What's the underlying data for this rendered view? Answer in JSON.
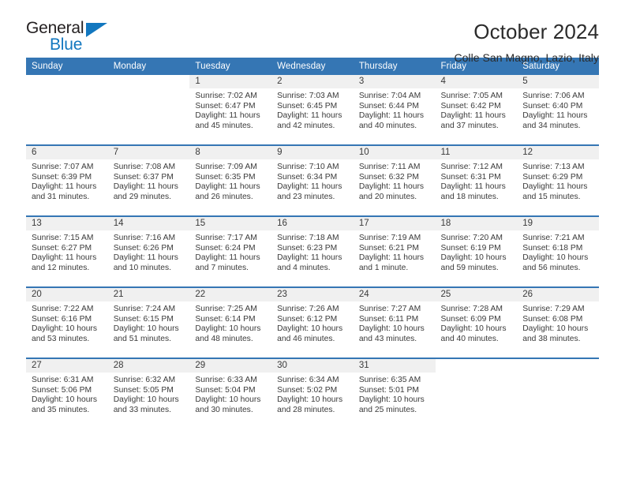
{
  "brand": {
    "name_top": "General",
    "name_bottom": "Blue",
    "triangle_icon": "brand-triangle-icon"
  },
  "header": {
    "title": "October 2024",
    "subtitle": "Colle San Magno, Lazio, Italy"
  },
  "colors": {
    "header_blue": "#3576b4",
    "brand_blue": "#1277bf",
    "daynum_band": "#f0f0f0",
    "text": "#3a3a3a"
  },
  "weekday_headers": [
    "Sunday",
    "Monday",
    "Tuesday",
    "Wednesday",
    "Thursday",
    "Friday",
    "Saturday"
  ],
  "weeks": [
    [
      {
        "day": "",
        "lines": []
      },
      {
        "day": "",
        "lines": []
      },
      {
        "day": "1",
        "lines": [
          "Sunrise: 7:02 AM",
          "Sunset: 6:47 PM",
          "Daylight: 11 hours",
          "and 45 minutes."
        ]
      },
      {
        "day": "2",
        "lines": [
          "Sunrise: 7:03 AM",
          "Sunset: 6:45 PM",
          "Daylight: 11 hours",
          "and 42 minutes."
        ]
      },
      {
        "day": "3",
        "lines": [
          "Sunrise: 7:04 AM",
          "Sunset: 6:44 PM",
          "Daylight: 11 hours",
          "and 40 minutes."
        ]
      },
      {
        "day": "4",
        "lines": [
          "Sunrise: 7:05 AM",
          "Sunset: 6:42 PM",
          "Daylight: 11 hours",
          "and 37 minutes."
        ]
      },
      {
        "day": "5",
        "lines": [
          "Sunrise: 7:06 AM",
          "Sunset: 6:40 PM",
          "Daylight: 11 hours",
          "and 34 minutes."
        ]
      }
    ],
    [
      {
        "day": "6",
        "lines": [
          "Sunrise: 7:07 AM",
          "Sunset: 6:39 PM",
          "Daylight: 11 hours",
          "and 31 minutes."
        ]
      },
      {
        "day": "7",
        "lines": [
          "Sunrise: 7:08 AM",
          "Sunset: 6:37 PM",
          "Daylight: 11 hours",
          "and 29 minutes."
        ]
      },
      {
        "day": "8",
        "lines": [
          "Sunrise: 7:09 AM",
          "Sunset: 6:35 PM",
          "Daylight: 11 hours",
          "and 26 minutes."
        ]
      },
      {
        "day": "9",
        "lines": [
          "Sunrise: 7:10 AM",
          "Sunset: 6:34 PM",
          "Daylight: 11 hours",
          "and 23 minutes."
        ]
      },
      {
        "day": "10",
        "lines": [
          "Sunrise: 7:11 AM",
          "Sunset: 6:32 PM",
          "Daylight: 11 hours",
          "and 20 minutes."
        ]
      },
      {
        "day": "11",
        "lines": [
          "Sunrise: 7:12 AM",
          "Sunset: 6:31 PM",
          "Daylight: 11 hours",
          "and 18 minutes."
        ]
      },
      {
        "day": "12",
        "lines": [
          "Sunrise: 7:13 AM",
          "Sunset: 6:29 PM",
          "Daylight: 11 hours",
          "and 15 minutes."
        ]
      }
    ],
    [
      {
        "day": "13",
        "lines": [
          "Sunrise: 7:15 AM",
          "Sunset: 6:27 PM",
          "Daylight: 11 hours",
          "and 12 minutes."
        ]
      },
      {
        "day": "14",
        "lines": [
          "Sunrise: 7:16 AM",
          "Sunset: 6:26 PM",
          "Daylight: 11 hours",
          "and 10 minutes."
        ]
      },
      {
        "day": "15",
        "lines": [
          "Sunrise: 7:17 AM",
          "Sunset: 6:24 PM",
          "Daylight: 11 hours",
          "and 7 minutes."
        ]
      },
      {
        "day": "16",
        "lines": [
          "Sunrise: 7:18 AM",
          "Sunset: 6:23 PM",
          "Daylight: 11 hours",
          "and 4 minutes."
        ]
      },
      {
        "day": "17",
        "lines": [
          "Sunrise: 7:19 AM",
          "Sunset: 6:21 PM",
          "Daylight: 11 hours",
          "and 1 minute."
        ]
      },
      {
        "day": "18",
        "lines": [
          "Sunrise: 7:20 AM",
          "Sunset: 6:19 PM",
          "Daylight: 10 hours",
          "and 59 minutes."
        ]
      },
      {
        "day": "19",
        "lines": [
          "Sunrise: 7:21 AM",
          "Sunset: 6:18 PM",
          "Daylight: 10 hours",
          "and 56 minutes."
        ]
      }
    ],
    [
      {
        "day": "20",
        "lines": [
          "Sunrise: 7:22 AM",
          "Sunset: 6:16 PM",
          "Daylight: 10 hours",
          "and 53 minutes."
        ]
      },
      {
        "day": "21",
        "lines": [
          "Sunrise: 7:24 AM",
          "Sunset: 6:15 PM",
          "Daylight: 10 hours",
          "and 51 minutes."
        ]
      },
      {
        "day": "22",
        "lines": [
          "Sunrise: 7:25 AM",
          "Sunset: 6:14 PM",
          "Daylight: 10 hours",
          "and 48 minutes."
        ]
      },
      {
        "day": "23",
        "lines": [
          "Sunrise: 7:26 AM",
          "Sunset: 6:12 PM",
          "Daylight: 10 hours",
          "and 46 minutes."
        ]
      },
      {
        "day": "24",
        "lines": [
          "Sunrise: 7:27 AM",
          "Sunset: 6:11 PM",
          "Daylight: 10 hours",
          "and 43 minutes."
        ]
      },
      {
        "day": "25",
        "lines": [
          "Sunrise: 7:28 AM",
          "Sunset: 6:09 PM",
          "Daylight: 10 hours",
          "and 40 minutes."
        ]
      },
      {
        "day": "26",
        "lines": [
          "Sunrise: 7:29 AM",
          "Sunset: 6:08 PM",
          "Daylight: 10 hours",
          "and 38 minutes."
        ]
      }
    ],
    [
      {
        "day": "27",
        "lines": [
          "Sunrise: 6:31 AM",
          "Sunset: 5:06 PM",
          "Daylight: 10 hours",
          "and 35 minutes."
        ]
      },
      {
        "day": "28",
        "lines": [
          "Sunrise: 6:32 AM",
          "Sunset: 5:05 PM",
          "Daylight: 10 hours",
          "and 33 minutes."
        ]
      },
      {
        "day": "29",
        "lines": [
          "Sunrise: 6:33 AM",
          "Sunset: 5:04 PM",
          "Daylight: 10 hours",
          "and 30 minutes."
        ]
      },
      {
        "day": "30",
        "lines": [
          "Sunrise: 6:34 AM",
          "Sunset: 5:02 PM",
          "Daylight: 10 hours",
          "and 28 minutes."
        ]
      },
      {
        "day": "31",
        "lines": [
          "Sunrise: 6:35 AM",
          "Sunset: 5:01 PM",
          "Daylight: 10 hours",
          "and 25 minutes."
        ]
      },
      {
        "day": "",
        "lines": []
      },
      {
        "day": "",
        "lines": []
      }
    ]
  ]
}
